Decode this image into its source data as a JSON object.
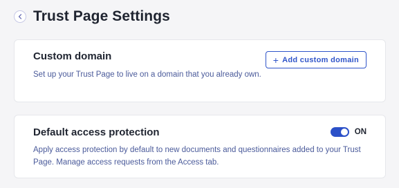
{
  "header": {
    "back_icon": "arrow-left-icon",
    "title": "Trust Page Settings"
  },
  "custom_domain": {
    "title": "Custom domain",
    "description": "Set up your Trust Page to live on a domain that you already own.",
    "button_icon": "plus-icon",
    "button_label": "Add custom domain"
  },
  "access_protection": {
    "title": "Default access protection",
    "description": "Apply access protection by default to new documents and questionnaires added to your Trust Page. Manage access requests from the Access tab.",
    "toggle_state": "ON",
    "toggle_on": true
  },
  "colors": {
    "accent": "#2b50c8",
    "description_text": "#4a5a9a",
    "background": "#f5f5f7"
  }
}
